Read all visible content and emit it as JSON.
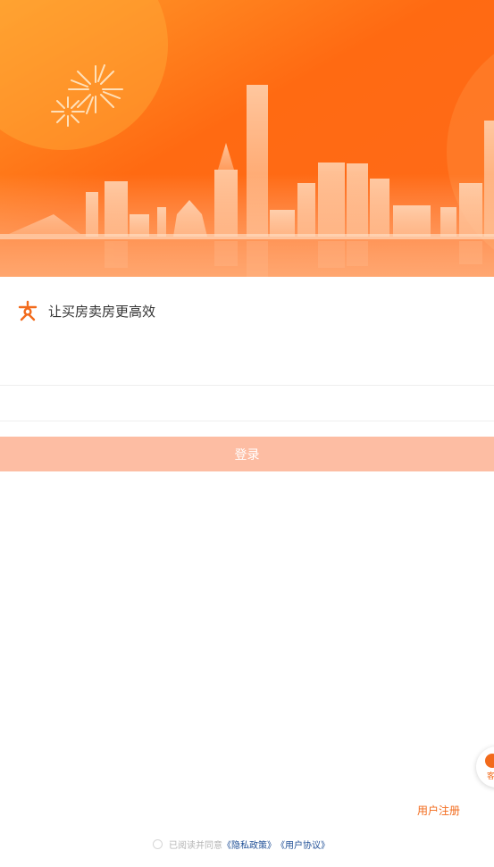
{
  "brand": {
    "slogan": "让买房卖房更高效",
    "accent_color": "#f26a1b",
    "logo_icon": "house-brand-logo"
  },
  "login": {
    "phone_placeholder": "",
    "code_placeholder": "",
    "submit_label": "登录",
    "submit_color": "#fdbda3"
  },
  "float_service": {
    "label": "客",
    "icon": "customer-service-icon"
  },
  "footer": {
    "register_label": "用户注册",
    "agree_prefix": "已阅读并同意",
    "privacy_label": "《隐私政策》",
    "agreement_label": "《用户协议》"
  }
}
